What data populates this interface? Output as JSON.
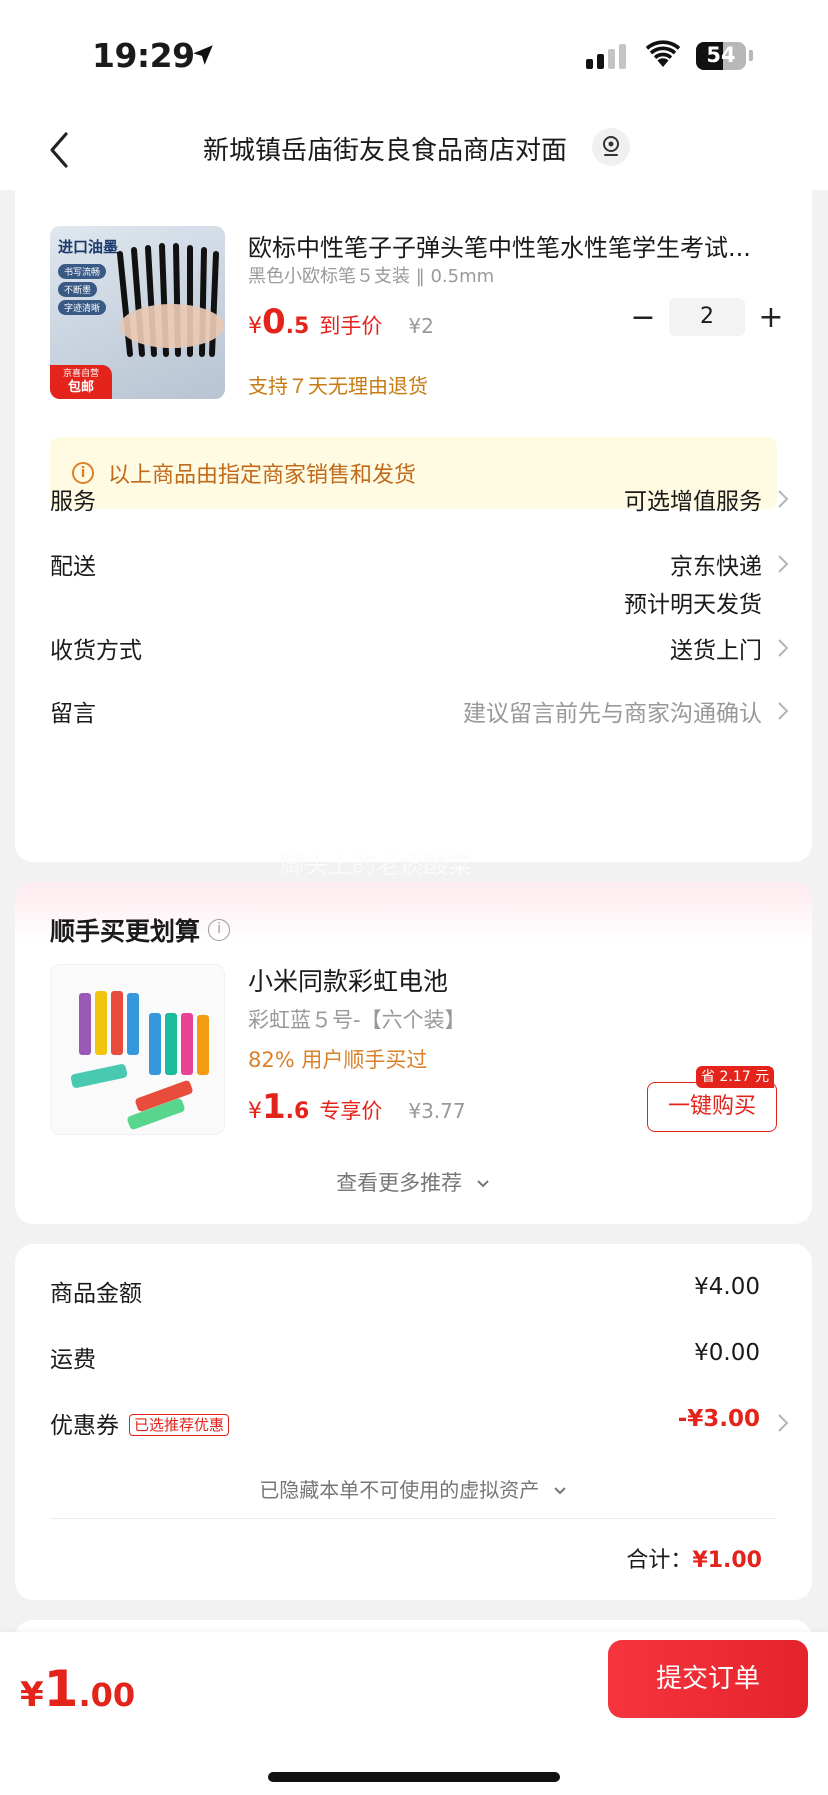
{
  "status_bar": {
    "time": "19:29",
    "battery": "54",
    "battery_level": 0.54
  },
  "header": {
    "address": "新城镇岳庙街友良食品商店对面"
  },
  "product": {
    "title": "欧标中性笔子子弹头笔中性笔水性笔学生考试...",
    "spec": "黑色小欧标笔５支装 ‖ 0.5mm",
    "price_currency": "¥",
    "price_int": "0",
    "price_dec": ".5",
    "price_label": "到手价",
    "original_price": "¥2",
    "quantity": "2",
    "minus": "−",
    "plus": "+",
    "returns": "支持７天无理由退货",
    "image_text": {
      "brand": "进口油墨",
      "f1": "书写流畅",
      "f2": "不断墨",
      "f3": "字迹清晰",
      "tag1": "京喜自营",
      "tag2": "包邮"
    }
  },
  "notice": {
    "text": "以上商品由指定商家销售和发货"
  },
  "order_rows": {
    "service": {
      "label": "服务",
      "value": "可选增值服务"
    },
    "delivery": {
      "label": "配送",
      "value": "京东快递",
      "value2": "预计明天发货"
    },
    "receive": {
      "label": "收货方式",
      "value": "送货上门"
    },
    "message": {
      "label": "留言",
      "placeholder": "建议留言前先与商家沟通确认"
    }
  },
  "watermark": "脚头上的老痰酸菜",
  "recommend": {
    "title": "顺手买更划算",
    "item_title": "小米同款彩虹电池",
    "item_spec": "彩虹蓝５号-【六个装】",
    "bought": "82% 用户顺手买过",
    "price_currency": "¥",
    "price_int": "1",
    "price_dec": ".6",
    "price_label": "专享价",
    "original_price": "¥3.77",
    "save_tag": "省 2.17 元",
    "buy_label": "一键购买",
    "more": "查看更多推荐"
  },
  "summary": {
    "goods_label": "商品金额",
    "goods_value": "¥4.00",
    "shipping_label": "运费",
    "shipping_value": "¥0.00",
    "coupon_label": "优惠券",
    "coupon_tag": "已选推荐优惠",
    "coupon_value": "-¥3.00",
    "hidden_note": "已隐藏本单不可使用的虚拟资产",
    "total_label": "合计：",
    "total_value": "¥1.00"
  },
  "footer": {
    "currency": "¥",
    "int": "1",
    "dec": ".00",
    "submit": "提交订单"
  },
  "colors": {
    "accent": "#e4231b",
    "orange": "#c77b12",
    "notice_bg": "#fffbe3"
  }
}
